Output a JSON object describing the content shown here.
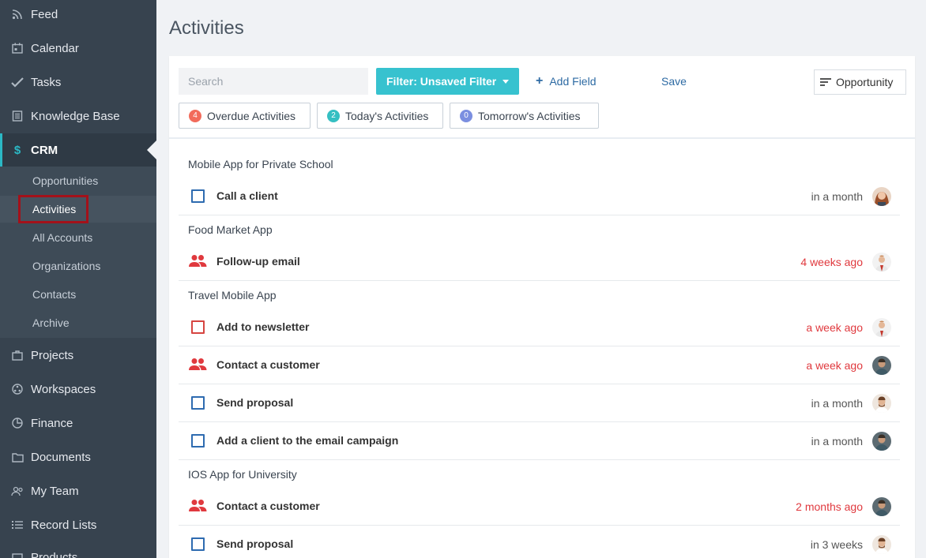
{
  "sidebar": {
    "items": [
      {
        "label": "Feed",
        "icon": "rss-icon"
      },
      {
        "label": "Calendar",
        "icon": "calendar-icon"
      },
      {
        "label": "Tasks",
        "icon": "check-icon"
      },
      {
        "label": "Knowledge Base",
        "icon": "book-icon"
      },
      {
        "label": "CRM",
        "icon": "dollar-icon"
      },
      {
        "label": "Projects",
        "icon": "briefcase-icon"
      },
      {
        "label": "Workspaces",
        "icon": "workspaces-icon"
      },
      {
        "label": "Finance",
        "icon": "pie-icon"
      },
      {
        "label": "Documents",
        "icon": "folder-icon"
      },
      {
        "label": "My Team",
        "icon": "team-icon"
      },
      {
        "label": "Record Lists",
        "icon": "list-icon"
      },
      {
        "label": "Products",
        "icon": "box-icon"
      }
    ],
    "crm_sub": [
      "Opportunities",
      "Activities",
      "All Accounts",
      "Organizations",
      "Contacts",
      "Archive"
    ],
    "accent": "#2bb8c5"
  },
  "page": {
    "title": "Activities"
  },
  "toolbar": {
    "search_placeholder": "Search",
    "filter_label": "Filter: Unsaved Filter",
    "add_field_label": "Add Field",
    "save_label": "Save",
    "sort_label": "Opportunity"
  },
  "pills": [
    {
      "count": "4",
      "label": "Overdue Activities",
      "color": "#f26b5b"
    },
    {
      "count": "2",
      "label": "Today's Activities",
      "color": "#35bfc2"
    },
    {
      "count": "0",
      "label": "Tomorrow's Activities",
      "color": "#7b8fe0"
    }
  ],
  "groups": [
    {
      "title": "Mobile App for Private School",
      "activities": [
        {
          "type": "task",
          "title": "Call a client",
          "when": "in a month",
          "overdue": false,
          "avatar": "woman"
        }
      ]
    },
    {
      "title": "Food Market App",
      "activities": [
        {
          "type": "meeting",
          "title": "Follow-up email",
          "when": "4 weeks ago",
          "overdue": true,
          "avatar": "man-light"
        }
      ]
    },
    {
      "title": "Travel Mobile App",
      "activities": [
        {
          "type": "task-overdue",
          "title": "Add to newsletter",
          "when": "a week ago",
          "overdue": true,
          "avatar": "man-light"
        },
        {
          "type": "meeting",
          "title": "Contact a customer",
          "when": "a week ago",
          "overdue": true,
          "avatar": "man-dark"
        },
        {
          "type": "task",
          "title": "Send proposal",
          "when": "in a month",
          "overdue": false,
          "avatar": "man-beard"
        },
        {
          "type": "task",
          "title": "Add a client to the email campaign",
          "when": "in a month",
          "overdue": false,
          "avatar": "man-dark"
        }
      ]
    },
    {
      "title": "IOS App for University",
      "activities": [
        {
          "type": "meeting",
          "title": "Contact a customer",
          "when": "2 months ago",
          "overdue": true,
          "avatar": "man-dark"
        },
        {
          "type": "task",
          "title": "Send proposal",
          "when": "in 3 weeks",
          "overdue": false,
          "avatar": "man-beard"
        }
      ]
    }
  ]
}
